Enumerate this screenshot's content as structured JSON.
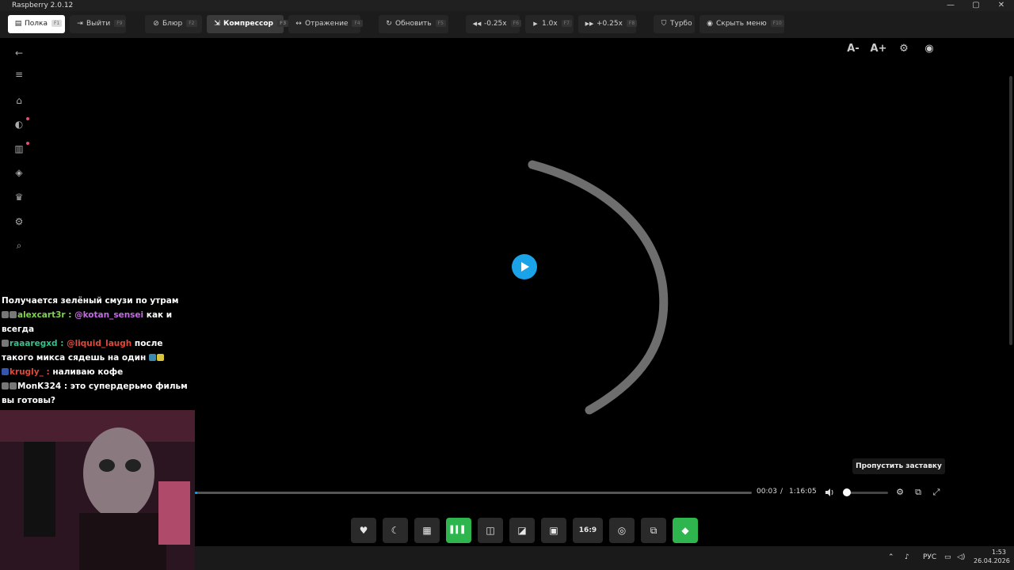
{
  "window": {
    "title": "Raspberry 2.0.12",
    "controls": [
      "—",
      "▢",
      "✕"
    ]
  },
  "toolbar": {
    "buttons": [
      {
        "label": "Полка",
        "key": "F1",
        "icon": "shelf-icon",
        "glyph": "▤"
      },
      {
        "label": "Выйти",
        "key": "F9",
        "icon": "exit-icon",
        "glyph": "⇥"
      },
      {
        "label": "Блюр",
        "key": "F2",
        "icon": "blur-off-icon",
        "glyph": "⊘"
      },
      {
        "label": "Компрессор",
        "key": "F3",
        "icon": "compressor-icon",
        "glyph": "⇲"
      },
      {
        "label": "Отражение",
        "key": "F4",
        "icon": "mirror-icon",
        "glyph": "↔"
      },
      {
        "label": "Обновить",
        "key": "F5",
        "icon": "refresh-icon",
        "glyph": "↻"
      },
      {
        "label": "-0.25x",
        "key": "F6",
        "icon": "rewind-icon",
        "glyph": "◀◀"
      },
      {
        "label": "1.0x",
        "key": "F7",
        "icon": "play-speed-icon",
        "glyph": "▶"
      },
      {
        "label": "+0.25x",
        "key": "F8",
        "icon": "forward-icon",
        "glyph": "▶▶"
      },
      {
        "label": "Турбо",
        "key": "",
        "icon": "shield-icon",
        "glyph": "⛉"
      },
      {
        "label": "Скрыть меню",
        "key": "F10",
        "icon": "eye-icon",
        "glyph": "◉"
      }
    ]
  },
  "sidebar": {
    "icons": [
      "back-arrow-icon",
      "menu-icon",
      "home-icon",
      "fire-icon",
      "book-icon",
      "compass-icon",
      "trophy-icon",
      "gear-icon",
      "search-icon"
    ],
    "glyphs": [
      "←",
      "≡",
      "⌂",
      "◐",
      "▥",
      "◈",
      "♛",
      "⚙",
      "⌕"
    ]
  },
  "player": {
    "top_controls": [
      "A-",
      "A+",
      "⚙",
      "◉"
    ],
    "skip_intro": "Пропустить заставку",
    "current_time": "00:03",
    "separator": "/",
    "duration": "1:16:05",
    "progress_fraction": 0.004,
    "volume_fraction": 0.08,
    "accent": "#1aa3e8"
  },
  "chat": {
    "lines": [
      {
        "text": "Получается зелёный смузи по утрам"
      },
      {
        "user": "alexcart3r",
        "sep": " : ",
        "mention": "@kotan_sensei",
        "msg": " как и"
      },
      {
        "text": "всегда"
      },
      {
        "user": "raaaregxd",
        "sep": " : ",
        "mention": "@liquid_laugh",
        "msg": " после"
      },
      {
        "text": "такого микса сядешь на один"
      },
      {
        "user": "krugly_",
        "sep": " : ",
        "msg": "наливаю кофе"
      },
      {
        "user": "MonK324",
        "sep": " : ",
        "msg": "это супердерьмо фильм"
      },
      {
        "text": "вы готовы?"
      }
    ]
  },
  "bottom_tools": [
    {
      "name": "favorite-button",
      "glyph": "♥"
    },
    {
      "name": "night-mode-button",
      "glyph": "☾"
    },
    {
      "name": "grid-button",
      "glyph": "▦"
    },
    {
      "name": "audio-button",
      "glyph": "▌▍▌"
    },
    {
      "name": "split-button",
      "glyph": "◫"
    },
    {
      "name": "crop-button",
      "glyph": "◪"
    },
    {
      "name": "pip-button",
      "glyph": "▣"
    },
    {
      "name": "aspect-button",
      "glyph": "16:9"
    },
    {
      "name": "focus-button",
      "glyph": "◎"
    },
    {
      "name": "copy-button",
      "glyph": "⧉"
    },
    {
      "name": "layers-button",
      "glyph": "◆"
    }
  ],
  "taskbar": {
    "lang": "РУС",
    "time": "1:53",
    "date": "26.04.2026"
  }
}
